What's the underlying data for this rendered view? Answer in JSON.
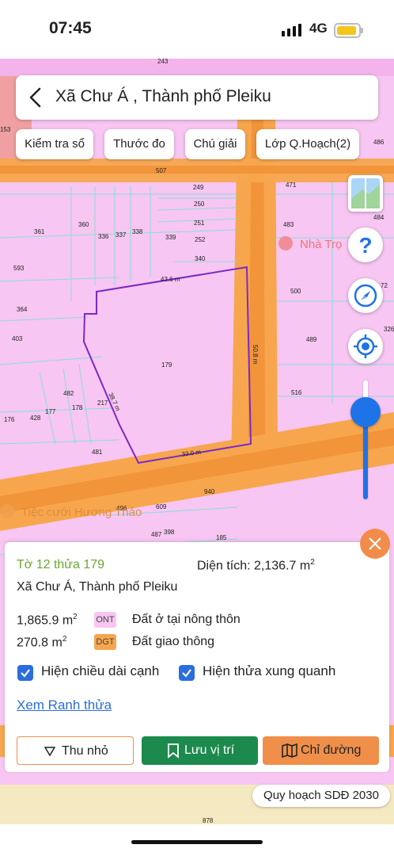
{
  "status_bar": {
    "time": "07:45",
    "network": "4G"
  },
  "header": {
    "title": "Xã Chư Á , Thành phố Pleiku"
  },
  "toolbar": {
    "check_book": "Kiểm tra sổ",
    "measure": "Thước đo",
    "legend": "Chú giải",
    "planning_layer": "Lớp Q.Hoạch(2)"
  },
  "map": {
    "parcel_labels": [
      "243",
      "153",
      "507",
      "249",
      "471",
      "486",
      "250",
      "251",
      "483",
      "484",
      "361",
      "360",
      "336",
      "337",
      "338",
      "339",
      "252",
      "340",
      "593",
      "364",
      "500",
      "72",
      "403",
      "489",
      "326",
      "179",
      "482",
      "516",
      "217",
      "178",
      "177",
      "428",
      "176",
      "481",
      "940",
      "496",
      "609",
      "487",
      "398",
      "185",
      "878"
    ],
    "edge_lengths": [
      "43.6 m",
      "50.8 m",
      "38.7 m",
      "33.0 m"
    ],
    "poi": [
      "Nhà Trọ",
      "Tiệc cưới Hương Thảo"
    ],
    "colors": {
      "residential": "#f7c6f2",
      "road": "#f7a64d",
      "road_core": "#f2943a",
      "boundary": "#7b2ac7",
      "agriculture": "#f0a0a0",
      "parcel_line": "#7fe0d8"
    }
  },
  "panel": {
    "parcel_id": "Tờ 12 thửa 179",
    "area_label": "Diện tích: 2,136.7 m",
    "area_sup": "2",
    "location": "Xã Chư Á, Thành phố Pleiku",
    "uses": [
      {
        "area": "1,865.9 m",
        "sup": "2",
        "code": "ONT",
        "name": "Đất ở tại nông thôn",
        "color": "#f7c6f2"
      },
      {
        "area": "270.8 m",
        "sup": "2",
        "code": "DGT",
        "name": "Đất giao thông",
        "color": "#f7a64d"
      }
    ],
    "show_edge_lengths": "Hiện chiều dài cạnh",
    "show_nearby": "Hiện thửa xung quanh",
    "view_boundary": "Xem Ranh thửa",
    "collapse": "Thu nhỏ",
    "save_location": "Lưu vị trí",
    "directions": "Chỉ đường"
  },
  "plan_label": "Quy hoạch SDĐ 2030"
}
